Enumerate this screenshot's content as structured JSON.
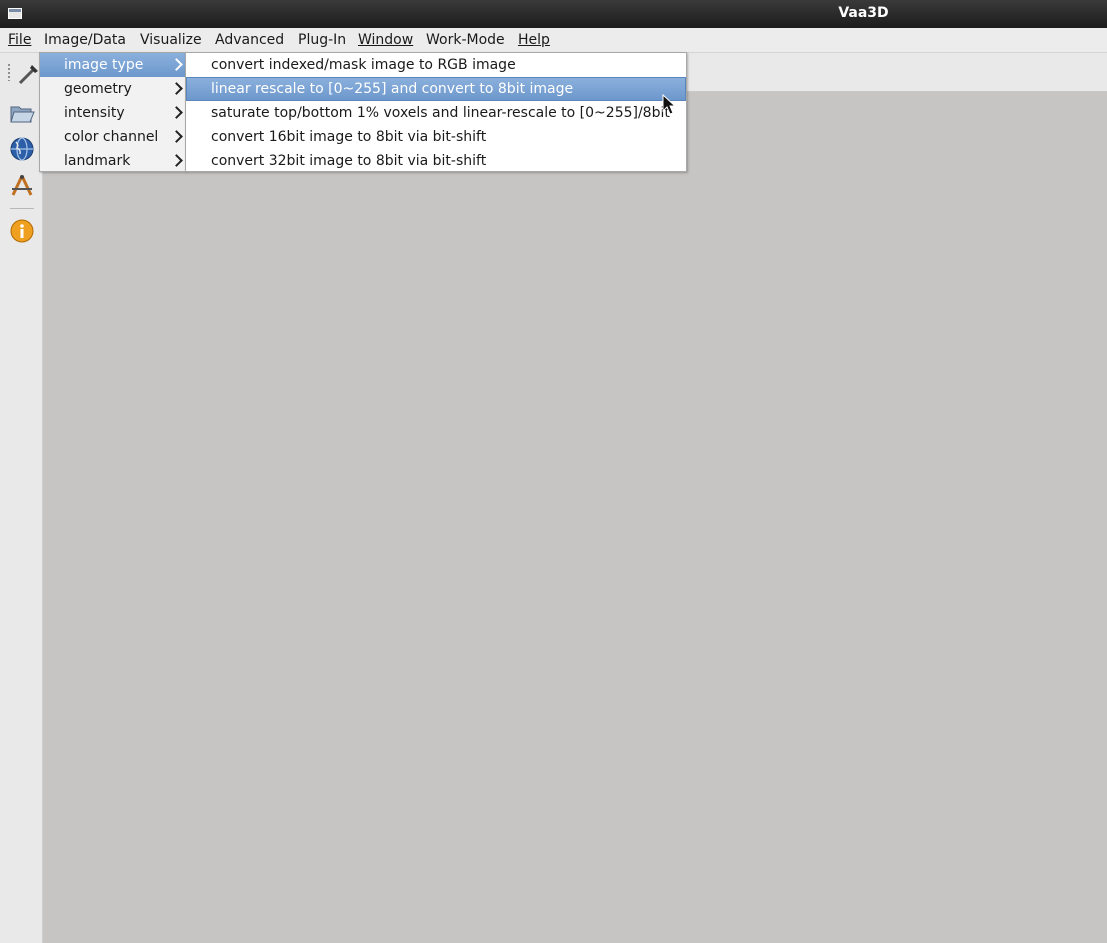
{
  "window": {
    "title": "Vaa3D"
  },
  "menubar": {
    "items": [
      {
        "label": "File",
        "underline": true
      },
      {
        "label": "Image/Data",
        "underline": false
      },
      {
        "label": "Visualize",
        "underline": false
      },
      {
        "label": "Advanced",
        "underline": false
      },
      {
        "label": "Plug-In",
        "underline": false
      },
      {
        "label": "Window",
        "underline": true
      },
      {
        "label": "Work-Mode",
        "underline": false
      },
      {
        "label": "Help",
        "underline": true
      }
    ]
  },
  "image_data_menu": {
    "items": [
      {
        "label": "image type",
        "selected": true
      },
      {
        "label": "geometry",
        "selected": false
      },
      {
        "label": "intensity",
        "selected": false
      },
      {
        "label": "color channel",
        "selected": false
      },
      {
        "label": "landmark",
        "selected": false
      }
    ]
  },
  "image_type_submenu": {
    "items": [
      {
        "label": "convert indexed/mask image to RGB image",
        "highlighted": false
      },
      {
        "label": "linear rescale to [0~255] and convert to 8bit image",
        "highlighted": true
      },
      {
        "label": "saturate top/bottom 1% voxels and linear-rescale to [0~255]/8bit",
        "highlighted": false
      },
      {
        "label": "convert 16bit image to 8bit via bit-shift",
        "highlighted": false
      },
      {
        "label": "convert 32bit image to 8bit via bit-shift",
        "highlighted": false
      }
    ]
  },
  "toolbar": {
    "icons": [
      "wand-tool-icon",
      "open-folder-icon",
      "web-globe-icon",
      "compass-tool-icon",
      "info-icon"
    ]
  },
  "colors": {
    "highlight": "#7aa2d4",
    "titlebar": "#2a2a2a",
    "workspace": "#c6c5c3"
  }
}
